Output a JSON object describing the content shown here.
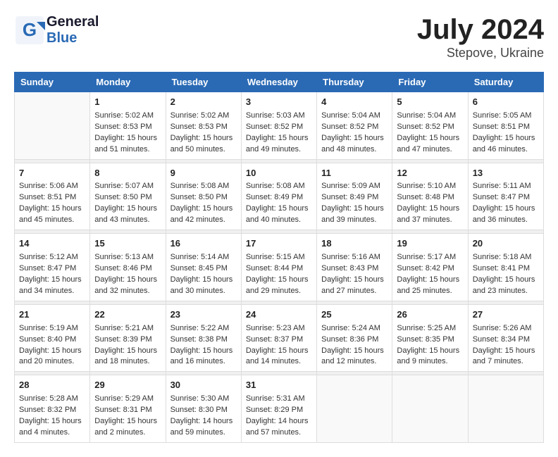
{
  "header": {
    "logo_line1": "General",
    "logo_line2": "Blue",
    "month_year": "July 2024",
    "location": "Stepove, Ukraine"
  },
  "weekdays": [
    "Sunday",
    "Monday",
    "Tuesday",
    "Wednesday",
    "Thursday",
    "Friday",
    "Saturday"
  ],
  "weeks": [
    [
      {
        "day": "",
        "info": ""
      },
      {
        "day": "1",
        "info": "Sunrise: 5:02 AM\nSunset: 8:53 PM\nDaylight: 15 hours\nand 51 minutes."
      },
      {
        "day": "2",
        "info": "Sunrise: 5:02 AM\nSunset: 8:53 PM\nDaylight: 15 hours\nand 50 minutes."
      },
      {
        "day": "3",
        "info": "Sunrise: 5:03 AM\nSunset: 8:52 PM\nDaylight: 15 hours\nand 49 minutes."
      },
      {
        "day": "4",
        "info": "Sunrise: 5:04 AM\nSunset: 8:52 PM\nDaylight: 15 hours\nand 48 minutes."
      },
      {
        "day": "5",
        "info": "Sunrise: 5:04 AM\nSunset: 8:52 PM\nDaylight: 15 hours\nand 47 minutes."
      },
      {
        "day": "6",
        "info": "Sunrise: 5:05 AM\nSunset: 8:51 PM\nDaylight: 15 hours\nand 46 minutes."
      }
    ],
    [
      {
        "day": "7",
        "info": "Sunrise: 5:06 AM\nSunset: 8:51 PM\nDaylight: 15 hours\nand 45 minutes."
      },
      {
        "day": "8",
        "info": "Sunrise: 5:07 AM\nSunset: 8:50 PM\nDaylight: 15 hours\nand 43 minutes."
      },
      {
        "day": "9",
        "info": "Sunrise: 5:08 AM\nSunset: 8:50 PM\nDaylight: 15 hours\nand 42 minutes."
      },
      {
        "day": "10",
        "info": "Sunrise: 5:08 AM\nSunset: 8:49 PM\nDaylight: 15 hours\nand 40 minutes."
      },
      {
        "day": "11",
        "info": "Sunrise: 5:09 AM\nSunset: 8:49 PM\nDaylight: 15 hours\nand 39 minutes."
      },
      {
        "day": "12",
        "info": "Sunrise: 5:10 AM\nSunset: 8:48 PM\nDaylight: 15 hours\nand 37 minutes."
      },
      {
        "day": "13",
        "info": "Sunrise: 5:11 AM\nSunset: 8:47 PM\nDaylight: 15 hours\nand 36 minutes."
      }
    ],
    [
      {
        "day": "14",
        "info": "Sunrise: 5:12 AM\nSunset: 8:47 PM\nDaylight: 15 hours\nand 34 minutes."
      },
      {
        "day": "15",
        "info": "Sunrise: 5:13 AM\nSunset: 8:46 PM\nDaylight: 15 hours\nand 32 minutes."
      },
      {
        "day": "16",
        "info": "Sunrise: 5:14 AM\nSunset: 8:45 PM\nDaylight: 15 hours\nand 30 minutes."
      },
      {
        "day": "17",
        "info": "Sunrise: 5:15 AM\nSunset: 8:44 PM\nDaylight: 15 hours\nand 29 minutes."
      },
      {
        "day": "18",
        "info": "Sunrise: 5:16 AM\nSunset: 8:43 PM\nDaylight: 15 hours\nand 27 minutes."
      },
      {
        "day": "19",
        "info": "Sunrise: 5:17 AM\nSunset: 8:42 PM\nDaylight: 15 hours\nand 25 minutes."
      },
      {
        "day": "20",
        "info": "Sunrise: 5:18 AM\nSunset: 8:41 PM\nDaylight: 15 hours\nand 23 minutes."
      }
    ],
    [
      {
        "day": "21",
        "info": "Sunrise: 5:19 AM\nSunset: 8:40 PM\nDaylight: 15 hours\nand 20 minutes."
      },
      {
        "day": "22",
        "info": "Sunrise: 5:21 AM\nSunset: 8:39 PM\nDaylight: 15 hours\nand 18 minutes."
      },
      {
        "day": "23",
        "info": "Sunrise: 5:22 AM\nSunset: 8:38 PM\nDaylight: 15 hours\nand 16 minutes."
      },
      {
        "day": "24",
        "info": "Sunrise: 5:23 AM\nSunset: 8:37 PM\nDaylight: 15 hours\nand 14 minutes."
      },
      {
        "day": "25",
        "info": "Sunrise: 5:24 AM\nSunset: 8:36 PM\nDaylight: 15 hours\nand 12 minutes."
      },
      {
        "day": "26",
        "info": "Sunrise: 5:25 AM\nSunset: 8:35 PM\nDaylight: 15 hours\nand 9 minutes."
      },
      {
        "day": "27",
        "info": "Sunrise: 5:26 AM\nSunset: 8:34 PM\nDaylight: 15 hours\nand 7 minutes."
      }
    ],
    [
      {
        "day": "28",
        "info": "Sunrise: 5:28 AM\nSunset: 8:32 PM\nDaylight: 15 hours\nand 4 minutes."
      },
      {
        "day": "29",
        "info": "Sunrise: 5:29 AM\nSunset: 8:31 PM\nDaylight: 15 hours\nand 2 minutes."
      },
      {
        "day": "30",
        "info": "Sunrise: 5:30 AM\nSunset: 8:30 PM\nDaylight: 14 hours\nand 59 minutes."
      },
      {
        "day": "31",
        "info": "Sunrise: 5:31 AM\nSunset: 8:29 PM\nDaylight: 14 hours\nand 57 minutes."
      },
      {
        "day": "",
        "info": ""
      },
      {
        "day": "",
        "info": ""
      },
      {
        "day": "",
        "info": ""
      }
    ]
  ]
}
